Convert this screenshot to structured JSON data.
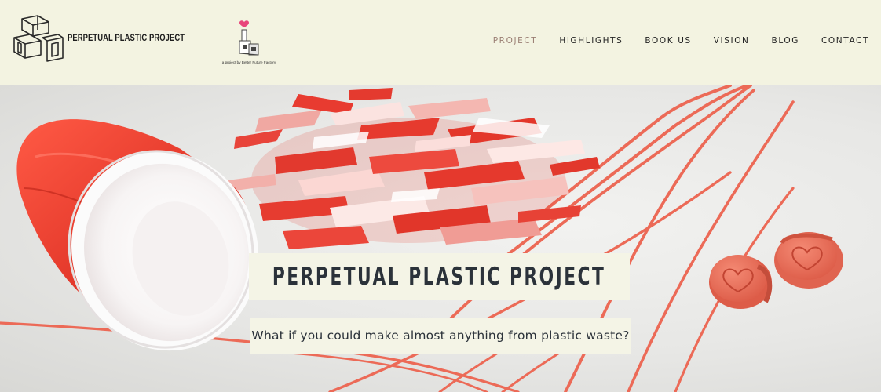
{
  "header": {
    "logo_text": "PERPETUAL PLASTIC PROJECT",
    "partner_caption": "a project by Better Future Factory"
  },
  "nav": [
    {
      "label": "PROJECT",
      "active": true
    },
    {
      "label": "HIGHLIGHTS"
    },
    {
      "label": "BOOK US"
    },
    {
      "label": "VISION"
    },
    {
      "label": "BLOG"
    },
    {
      "label": "CONTACT"
    }
  ],
  "hero": {
    "title": "PERPETUAL PLASTIC PROJECT",
    "subtitle": "What if you could make almost anything from plastic waste?"
  },
  "colors": {
    "header_bg": "#f3f3e1",
    "nav_active": "#9a7e73",
    "text_dark": "#2b323a",
    "cup_red": "#e53a2c",
    "filament": "#ec6a57",
    "heart_pink": "#e8457a"
  }
}
